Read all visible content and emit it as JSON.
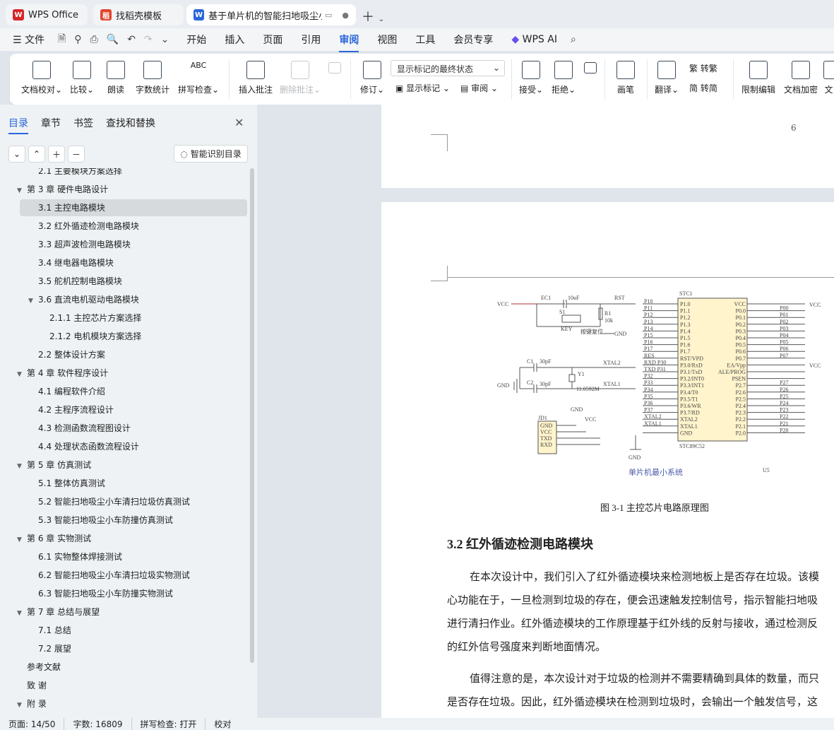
{
  "tabs": [
    {
      "label": "WPS Office",
      "icon": "wps-logo-icon",
      "color": "#d7262b"
    },
    {
      "label": "找稻壳模板",
      "icon": "docer-icon",
      "color": "#e2452c"
    },
    {
      "label": "基于单片机的智能扫地吸尘小",
      "icon": "word-doc-icon",
      "color": "#2b66d9"
    }
  ],
  "menu": {
    "file": "文件",
    "items": [
      "开始",
      "插入",
      "页面",
      "引用",
      "审阅",
      "视图",
      "工具",
      "会员专享"
    ],
    "active": "审阅",
    "ai": "WPS AI"
  },
  "ribbon": {
    "doc_check": "文档校对",
    "compare": "比较",
    "read_aloud": "朗读",
    "word_count": "字数统计",
    "spell_check": "拼写检查",
    "insert_comment": "插入批注",
    "delete_comment": "删除批注",
    "revise": "修订",
    "markup_mode": "显示标记的最终状态",
    "show_markup": "显示标记",
    "review": "审阅",
    "accept": "接受",
    "reject": "拒绝",
    "pen": "画笔",
    "translate": "翻译",
    "to_traditional": "转繁",
    "to_simplified": "转简",
    "restrict_edit": "限制编辑",
    "doc_encrypt": "文档加密",
    "doc_cut": "文"
  },
  "panel": {
    "tabs": [
      "目录",
      "章节",
      "书签",
      "查找和替换"
    ],
    "smart_toc": "智能识别目录"
  },
  "toc": [
    {
      "text": "2.1  主要模块方案选择",
      "level": 2,
      "caret": ""
    },
    {
      "text": "第 3 章  硬件电路设计",
      "level": 1,
      "caret": "▼"
    },
    {
      "text": "3.1 主控电路模块",
      "level": 2,
      "caret": "",
      "selected": true
    },
    {
      "text": "3.2  红外循迹检测电路模块",
      "level": 2,
      "caret": ""
    },
    {
      "text": "3.3 超声波检测电路模块",
      "level": 2,
      "caret": ""
    },
    {
      "text": "3.4  继电器电路模块",
      "level": 2,
      "caret": ""
    },
    {
      "text": "3.5  舵机控制电路模块",
      "level": 2,
      "caret": ""
    },
    {
      "text": "3.6  直流电机驱动电路模块",
      "level": 2,
      "caret": "▼"
    },
    {
      "text": "2.1.1  主控芯片方案选择",
      "level": 3,
      "caret": ""
    },
    {
      "text": "2.1.2  电机模块方案选择",
      "level": 3,
      "caret": ""
    },
    {
      "text": "2.2  整体设计方案",
      "level": 2,
      "caret": ""
    },
    {
      "text": "第 4 章  软件程序设计",
      "level": 1,
      "caret": "▼"
    },
    {
      "text": "4.1  编程软件介绍",
      "level": 2,
      "caret": ""
    },
    {
      "text": "4.2  主程序流程设计",
      "level": 2,
      "caret": ""
    },
    {
      "text": "4.3  检测函数流程图设计",
      "level": 2,
      "caret": ""
    },
    {
      "text": "4.4  处理状态函数流程设计",
      "level": 2,
      "caret": ""
    },
    {
      "text": "第 5 章  仿真测试",
      "level": 1,
      "caret": "▼"
    },
    {
      "text": "5.1  整体仿真测试",
      "level": 2,
      "caret": ""
    },
    {
      "text": "5.2  智能扫地吸尘小车清扫垃圾仿真测试",
      "level": 2,
      "caret": ""
    },
    {
      "text": "5.3  智能扫地吸尘小车防撞仿真测试",
      "level": 2,
      "caret": ""
    },
    {
      "text": "第 6 章  实物测试",
      "level": 1,
      "caret": "▼"
    },
    {
      "text": "6.1  实物整体焊接测试",
      "level": 2,
      "caret": ""
    },
    {
      "text": "6.2  智能扫地吸尘小车清扫垃圾实物测试",
      "level": 2,
      "caret": ""
    },
    {
      "text": "6.3  智能扫地吸尘小车防撞实物测试",
      "level": 2,
      "caret": ""
    },
    {
      "text": "第 7 章  总结与展望",
      "level": 1,
      "caret": "▼"
    },
    {
      "text": "7.1  总结",
      "level": 2,
      "caret": ""
    },
    {
      "text": "7.2  展望",
      "level": 2,
      "caret": ""
    },
    {
      "text": "参考文献",
      "level": 1,
      "caret": ""
    },
    {
      "text": "致    谢",
      "level": 1,
      "caret": ""
    },
    {
      "text": "附    录",
      "level": 1,
      "caret": "▼"
    }
  ],
  "document": {
    "page_number": "6",
    "figure_caption": "图 3-1 主控芯片电路原理图",
    "heading": "3.2  红外循迹检测电路模块",
    "paragraphs": [
      "在本次设计中，我们引入了红外循迹模块来检测地板上是否存在垃圾。该模",
      "心功能在于，一旦检测到垃圾的存在，便会迅速触发控制信号，指示智能扫地吸",
      "进行清扫作业。红外循迹模块的工作原理基于红外线的反射与接收，通过检测反",
      "的红外信号强度来判断地面情况。",
      "值得注意的是，本次设计对于垃圾的检测并不需要精确到具体的数量，而只",
      "是否存在垃圾。因此，红外循迹模块在检测到垃圾时，会输出一个触发信号，这"
    ],
    "schematic": {
      "title": "单片机最小系统",
      "chip": "STC89C52",
      "chip_ref": "STC1",
      "u_label": "U5",
      "vcc": "VCC",
      "gnd": "GND",
      "rst": "RST",
      "xtal1": "XTAL1",
      "xtal2": "XTAL2",
      "crystal": "11.0592M",
      "cap1": "30pF",
      "cap2": "30pF",
      "ec1": "EC1",
      "ec1_val": "10uF",
      "r1": "R1",
      "r1_val": "10k",
      "key": "KEY",
      "key_label": "按键复位",
      "j_label": "JD1",
      "left_pins": [
        "P1.0",
        "P1.1",
        "P1.2",
        "P1.3",
        "P1.4",
        "P1.5",
        "P1.6",
        "P1.7",
        "RST/VPD",
        "P3.0/RxD",
        "P3.1/TxD",
        "P3.2/INT0",
        "P3.3/INT1",
        "P3.4/T0",
        "P3.5/T1",
        "P3.6/WR",
        "P3.7/RD",
        "XTAL2",
        "XTAL1",
        "GND"
      ],
      "right_pins": [
        "VCC",
        "P0.0",
        "P0.1",
        "P0.2",
        "P0.3",
        "P0.4",
        "P0.5",
        "P0.6",
        "P0.7",
        "EA/Vpp",
        "ALE/PROG",
        "PSEN",
        "P2.7",
        "P2.6",
        "P2.5",
        "P2.4",
        "P2.3",
        "P2.2",
        "P2.1",
        "P2.0"
      ],
      "left_nets": [
        "P10",
        "P11",
        "P12",
        "P13",
        "P14",
        "P15",
        "P16",
        "P17",
        "RES",
        "RXD P30",
        "TXD P31",
        "P32",
        "P33",
        "P34",
        "P35",
        "P36",
        "P37",
        "XTAL2",
        "XTAL1",
        ""
      ],
      "right_nets": [
        "",
        "P00",
        "P01",
        "P02",
        "P03",
        "P04",
        "P05",
        "P06",
        "P07",
        "",
        "",
        "",
        "P27",
        "P26",
        "P25",
        "P24",
        "P23",
        "P22",
        "P21",
        "P20"
      ],
      "jd_pins": [
        "GND",
        "VCC",
        "TXD",
        "RXD"
      ]
    }
  },
  "status": {
    "page": "页面: 14/50",
    "words": "字数: 16809",
    "spell": "拼写检查: 打开",
    "proof": "校对"
  }
}
